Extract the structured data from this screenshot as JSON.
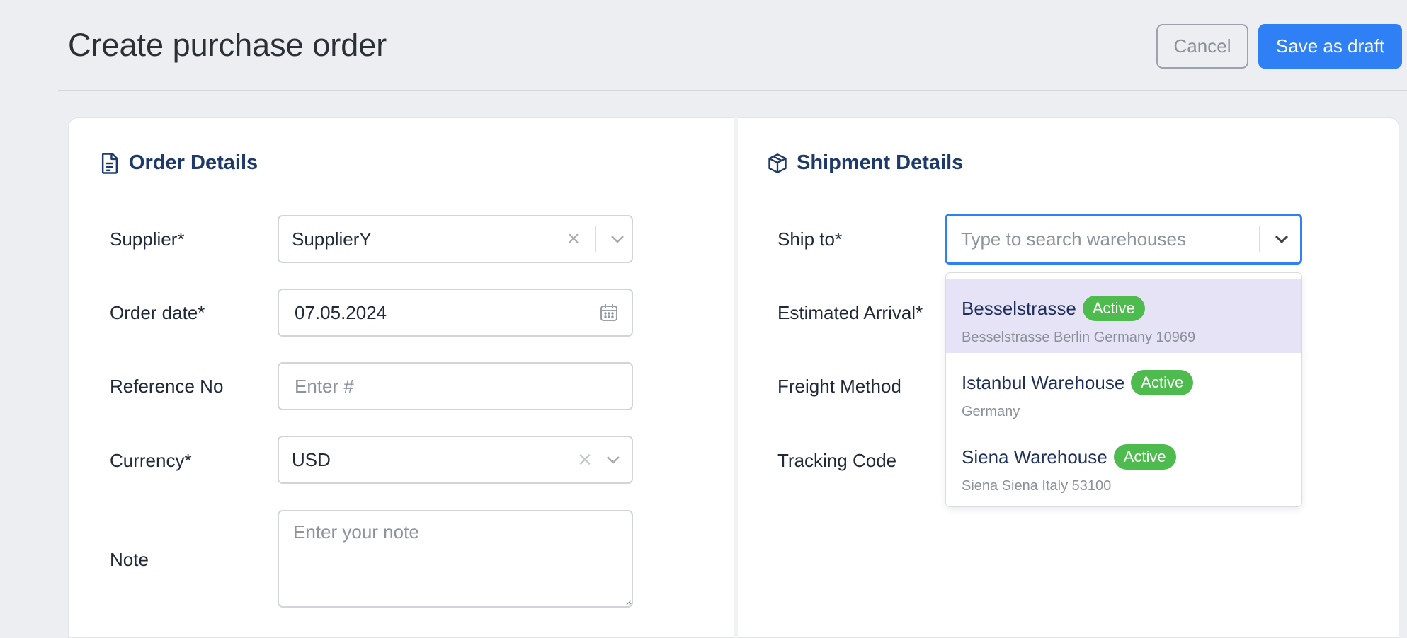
{
  "header": {
    "title": "Create purchase order",
    "cancel_label": "Cancel",
    "save_label": "Save as draft"
  },
  "order_details": {
    "heading": "Order Details",
    "icon": "document-icon",
    "supplier": {
      "label": "Supplier*",
      "value": "SupplierY"
    },
    "order_date": {
      "label": "Order date*",
      "value": "07.05.2024"
    },
    "reference_no": {
      "label": "Reference No",
      "placeholder": "Enter #"
    },
    "currency": {
      "label": "Currency*",
      "value": "USD"
    },
    "note": {
      "label": "Note",
      "placeholder": "Enter your note"
    }
  },
  "shipment_details": {
    "heading": "Shipment Details",
    "icon": "box-icon",
    "ship_to": {
      "label": "Ship to*",
      "placeholder": "Type to search warehouses"
    },
    "estimated_arrival": {
      "label": "Estimated Arrival*"
    },
    "freight_method": {
      "label": "Freight Method"
    },
    "tracking_code": {
      "label": "Tracking Code"
    }
  },
  "warehouse_options": [
    {
      "name": "Besselstrasse",
      "status": "Active",
      "address": "Besselstrasse Berlin Germany 10969"
    },
    {
      "name": "Istanbul Warehouse",
      "status": "Active",
      "address": "Germany"
    },
    {
      "name": "Siena Warehouse",
      "status": "Active",
      "address": "Siena Siena Italy 53100"
    }
  ],
  "colors": {
    "primary": "#2f7ff5",
    "heading": "#1e3a6b",
    "active_badge": "#4dbb4d",
    "selected_option": "#e6e3f6"
  }
}
